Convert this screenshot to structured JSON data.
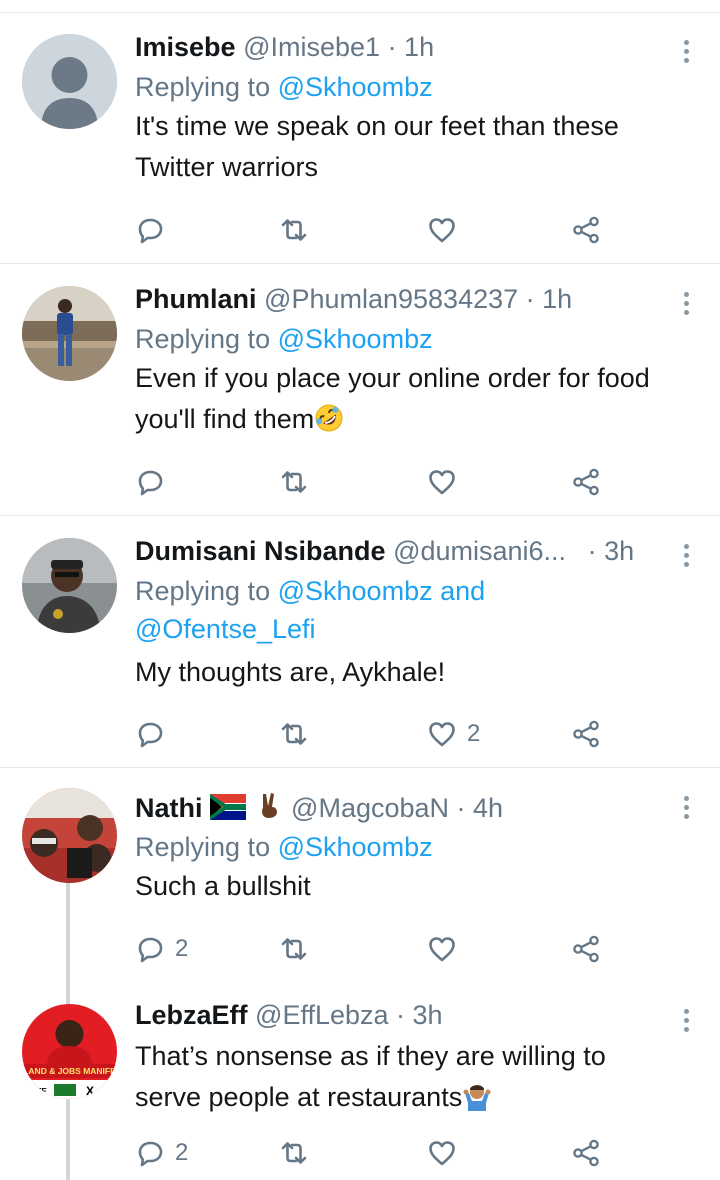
{
  "replies": [
    {
      "name": "Imisebe",
      "handle": "@Imisebe1",
      "time": "· 1h",
      "replying_prefix": "Replying to",
      "replying_to": "@Skhoombz",
      "text_line1": "It's time we speak on our feet than these",
      "text_line2": "Twitter warriors"
    },
    {
      "name": "Phumlani",
      "handle": "@Phumlan95834237",
      "time": "· 1h",
      "replying_prefix": "Replying to",
      "replying_to": "@Skhoombz",
      "text_line1": "Even if you place your online order for food",
      "text_line2": "you'll find them",
      "emoji": "rolling-on-floor-laughing-emoji"
    },
    {
      "name": "Dumisani Nsibande",
      "handle": "@dumisani6...",
      "time": "· 3h",
      "replying_prefix": "Replying to",
      "replying_to": "@Skhoombz and",
      "replying_to_2": "@Ofentse_Lefi",
      "text_line1": "My thoughts are, Aykhale!",
      "like_count": "2"
    },
    {
      "name": "Nathi",
      "name_emojis": [
        "south-africa-flag-emoji",
        "victory-hand-emoji"
      ],
      "handle": "@MagcobaN",
      "time": "· 4h",
      "replying_prefix": "Replying to",
      "replying_to": "@Skhoombz",
      "text_line1": "Such a bullshit",
      "reply_count": "2"
    },
    {
      "name": "LebzaEff",
      "handle": "@EffLebza",
      "time": "· 3h",
      "text_line1": "That’s nonsense as if they are willing to",
      "text_line2": "serve people at restaurants",
      "emoji": "man-shrugging-emoji",
      "reply_count": "2",
      "avatar_text_1": "LAND & JOBS MANIFE",
      "avatar_text_2": "VOTE",
      "avatar_text_3": "X"
    }
  ],
  "colors": {
    "link": "#1da1f2",
    "secondary": "#657786",
    "divider": "#e1e8ed",
    "icon": "#657786"
  }
}
